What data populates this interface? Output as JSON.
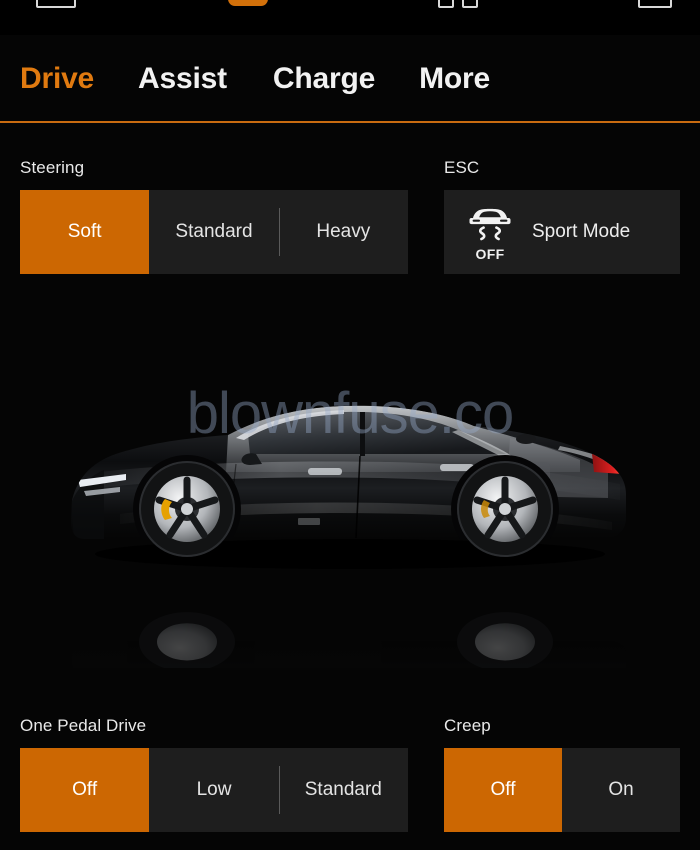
{
  "app": {
    "accent_orange": "#cc6702",
    "tab_active_color": "#e07a10",
    "card_bg": "#1e1e1e",
    "page_bg": "#0a0a0a"
  },
  "tabs": [
    {
      "label": "Drive",
      "active": true
    },
    {
      "label": "Assist",
      "active": false
    },
    {
      "label": "Charge",
      "active": false
    },
    {
      "label": "More",
      "active": false
    }
  ],
  "steering": {
    "label": "Steering",
    "options": [
      {
        "label": "Soft",
        "selected": true
      },
      {
        "label": "Standard",
        "selected": false
      },
      {
        "label": "Heavy",
        "selected": false
      }
    ]
  },
  "esc": {
    "label": "ESC",
    "button_label": "Sport Mode",
    "icon": "esc-off-icon",
    "icon_status_text": "OFF"
  },
  "one_pedal_drive": {
    "label": "One Pedal Drive",
    "options": [
      {
        "label": "Off",
        "selected": true
      },
      {
        "label": "Low",
        "selected": false
      },
      {
        "label": "Standard",
        "selected": false
      }
    ]
  },
  "creep": {
    "label": "Creep",
    "options": [
      {
        "label": "Off",
        "selected": true
      },
      {
        "label": "On",
        "selected": false
      }
    ]
  },
  "car": {
    "alt": "black polestar sedan side view with reflection"
  },
  "watermark": {
    "text": "blownfuse.co"
  }
}
